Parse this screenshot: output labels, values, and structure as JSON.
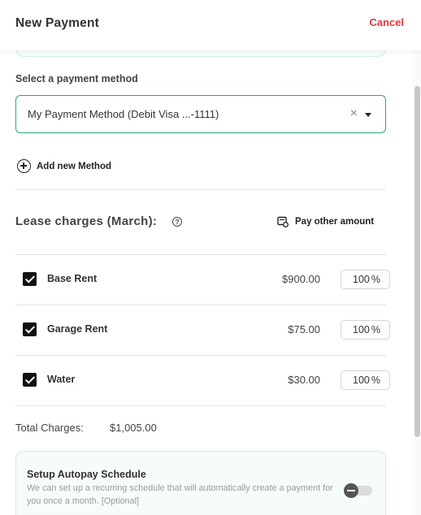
{
  "header": {
    "title": "New Payment",
    "cancel_label": "Cancel"
  },
  "payment": {
    "section_label": "Select a payment method",
    "selected_method": "My Payment Method (Debit Visa ...-1111)",
    "clear_icon": "close-icon",
    "add_method_label": "Add new Method"
  },
  "lease": {
    "title": "Lease charges (March):",
    "pay_other_label": "Pay other amount",
    "charges": [
      {
        "name": "Base Rent",
        "amount": "$900.00",
        "percent": "100",
        "checked": true
      },
      {
        "name": "Garage Rent",
        "amount": "$75.00",
        "percent": "100",
        "checked": true
      },
      {
        "name": "Water",
        "amount": "$30.00",
        "percent": "100",
        "checked": true
      }
    ],
    "percent_sign": "%"
  },
  "total": {
    "label": "Total Charges:",
    "value": "$1,005.00"
  },
  "autopay": {
    "title": "Setup Autopay Schedule",
    "description": "We can set up a recurring schedule that will automatically create a payment for you once a month. [Optional]",
    "enabled": false
  },
  "colors": {
    "accent_green": "#2aa87a",
    "cancel_red": "#e0383e",
    "autopay_bg": "#f6fcfb"
  }
}
